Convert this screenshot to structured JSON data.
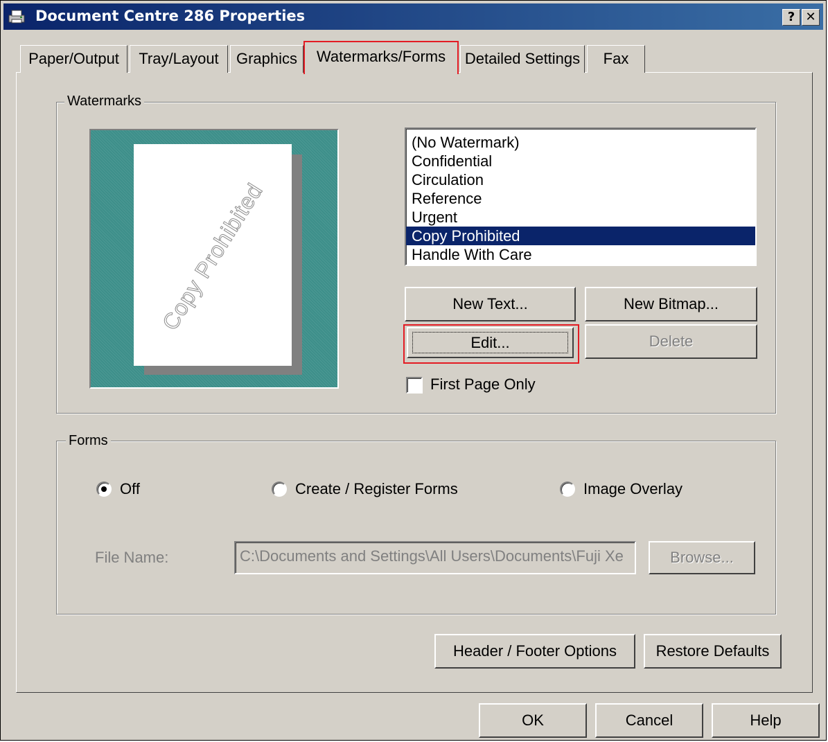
{
  "window": {
    "title": "Document Centre 286 Properties",
    "help_label": "?",
    "close_label": "✕",
    "icon": "printer-icon"
  },
  "tabs": [
    "Paper/Output",
    "Tray/Layout",
    "Graphics",
    "Watermarks/Forms",
    "Detailed Settings",
    "Fax"
  ],
  "active_tab": "Watermarks/Forms",
  "watermarks": {
    "group_label": "Watermarks",
    "preview_text": "Copy Prohibited",
    "list": [
      "(No Watermark)",
      "Confidential",
      "Circulation",
      "Reference",
      "Urgent",
      "Copy Prohibited",
      "Handle With Care"
    ],
    "selected": "Copy Prohibited",
    "new_text_label": "New Text...",
    "new_bitmap_label": "New Bitmap...",
    "edit_label": "Edit...",
    "delete_label": "Delete",
    "first_page_only_label": "First Page Only",
    "first_page_only_checked": false
  },
  "forms": {
    "group_label": "Forms",
    "options": [
      "Off",
      "Create / Register Forms",
      "Image Overlay"
    ],
    "selected": "Off",
    "file_name_label": "File Name:",
    "file_name_value": "C:\\Documents and Settings\\All Users\\Documents\\Fuji Xe",
    "browse_label": "Browse..."
  },
  "header_footer_label": "Header / Footer Options",
  "restore_defaults_label": "Restore Defaults",
  "footer": {
    "ok_label": "OK",
    "cancel_label": "Cancel",
    "help_label": "Help"
  },
  "colors": {
    "title_bar": "#0a246a",
    "face": "#d4d0c8",
    "selection": "#0a246a",
    "highlight_box": "#e31b23",
    "preview_bg": "#3d8f8a"
  }
}
